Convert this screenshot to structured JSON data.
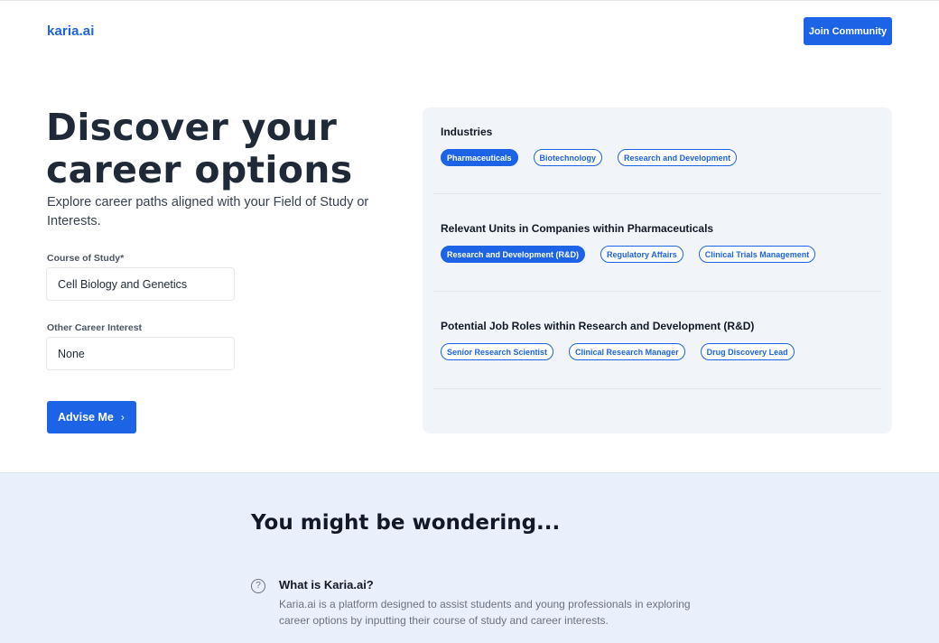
{
  "header": {
    "logo": "karia.ai",
    "join_label": "Join Community"
  },
  "hero": {
    "title": "Discover your career options",
    "subtitle": "Explore career paths aligned with your Field of Study or Interests."
  },
  "form": {
    "course_label": "Course of Study*",
    "course_value": "Cell Biology and Genetics",
    "interest_label": "Other Career Interest",
    "interest_value": "None",
    "submit_label": "Advise Me",
    "submit_icon": "chevron-right-icon"
  },
  "panel": {
    "industries": {
      "heading": "Industries",
      "chips": [
        "Pharmaceuticals",
        "Biotechnology",
        "Research and Development"
      ],
      "selected": 0
    },
    "units": {
      "heading": "Relevant Units in Companies within Pharmaceuticals",
      "chips": [
        "Research and Development (R&D)",
        "Regulatory Affairs",
        "Clinical Trials Management"
      ],
      "selected": 0
    },
    "roles": {
      "heading": "Potential Job Roles within Research and Development (R&D)",
      "chips": [
        "Senior Research Scientist",
        "Clinical Research Manager",
        "Drug Discovery Lead"
      ],
      "selected": -1
    }
  },
  "faq": {
    "title": "You might be wondering...",
    "items": [
      {
        "icon": "question-circle-icon",
        "question": "What is Karia.ai?",
        "answer": "Karia.ai is a platform designed to assist students and young professionals in exploring career options by inputting their course of study and career interests."
      }
    ]
  },
  "colors": {
    "accent": "#1d63e6",
    "panel_bg": "#f1f5f9",
    "faq_bg": "#e8f0fc"
  }
}
